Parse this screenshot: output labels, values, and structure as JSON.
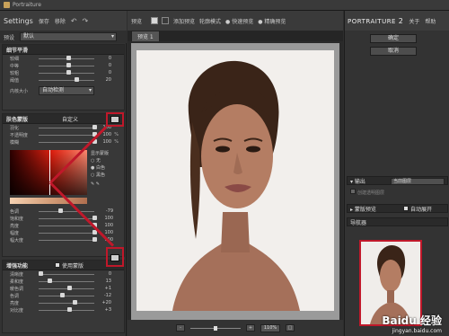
{
  "app": {
    "title": "Portraiture"
  },
  "left": {
    "title": "Settings",
    "save": "保存",
    "delete": "移除",
    "undo_icon": "undo-icon",
    "redo_icon": "redo-icon",
    "preset_label": "预设",
    "preset_value": "默认",
    "detail": {
      "title": "细节平滑",
      "rows": [
        {
          "label": "较细",
          "value": "0"
        },
        {
          "label": "中等",
          "value": "0"
        },
        {
          "label": "较粗",
          "value": "0"
        },
        {
          "label": "阈值",
          "value": "20"
        }
      ],
      "size_label": "内核大小",
      "size_value": "自动检测"
    },
    "mask": {
      "title": "肤色蒙版",
      "custom": "自定义",
      "rows": [
        {
          "label": "羽化",
          "value": "100"
        },
        {
          "label": "不透明度",
          "value": "100",
          "unit": "%"
        },
        {
          "label": "模糊",
          "value": "100",
          "unit": "%"
        }
      ],
      "show_mask": "显示蒙版",
      "options": [
        "无",
        "白色",
        "黑色"
      ],
      "rows2": [
        {
          "label": "色调",
          "value": "-79"
        },
        {
          "label": "饱和度",
          "value": "100"
        },
        {
          "label": "亮度",
          "value": "100"
        },
        {
          "label": "幅度",
          "value": "100"
        },
        {
          "label": "幅大度",
          "value": "100"
        }
      ]
    },
    "enhance": {
      "title": "增强功能",
      "use_mask": "使用蒙版",
      "rows": [
        {
          "label": "清晰度",
          "value": "0"
        },
        {
          "label": "柔和度",
          "value": "13"
        },
        {
          "label": "暖色调",
          "value": "+1"
        },
        {
          "label": "色调",
          "value": "-12"
        },
        {
          "label": "亮度",
          "value": "+20"
        },
        {
          "label": "对比度",
          "value": "+3"
        }
      ]
    }
  },
  "center": {
    "preview": "预览",
    "add_preview": "添加预览",
    "contour": "轮廓模式",
    "fast_preview": "快速预览",
    "precise_preview": "精确预览",
    "tab": "预览 1",
    "zoom": "110%"
  },
  "right": {
    "brand_left": "PORTRAITURE",
    "brand_num": "2",
    "about": "关于",
    "help": "帮助",
    "ok": "确定",
    "cancel": "取消",
    "output_label": "输出",
    "output_value": "当前图层",
    "new_layer": "创建透明图层",
    "mask_preview": "蒙版预览",
    "auto_open": "自动展开",
    "navigator": "导航器"
  },
  "watermark": {
    "line1": "Baidu 经验",
    "line2": "jingyan.baidu.com"
  },
  "colors": {
    "accent_red": "#c0182a"
  }
}
